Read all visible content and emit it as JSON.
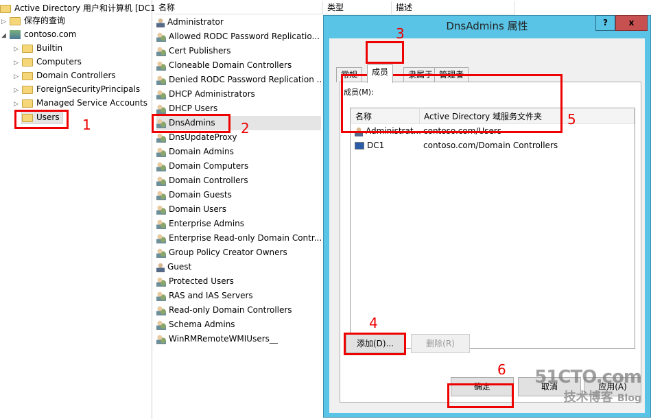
{
  "tree": {
    "root": "Active Directory 用户和计算机 [DC1.",
    "items": [
      {
        "label": "保存的查询",
        "expander": "collapsed"
      },
      {
        "label": "contoso.com",
        "expander": "expanded"
      },
      {
        "label": "Builtin",
        "expander": "collapsed"
      },
      {
        "label": "Computers",
        "expander": "collapsed"
      },
      {
        "label": "Domain Controllers",
        "expander": "collapsed"
      },
      {
        "label": "ForeignSecurityPrincipals",
        "expander": "collapsed"
      },
      {
        "label": "Managed Service Accounts",
        "expander": "collapsed"
      },
      {
        "label": "Users",
        "selected": true
      }
    ]
  },
  "list": {
    "columns": [
      "名称",
      "类型",
      "描述"
    ],
    "rows": [
      {
        "name": "Administrator",
        "icon": "user-icon"
      },
      {
        "name": "Allowed RODC Password Replicatio...",
        "icon": "group-icon"
      },
      {
        "name": "Cert Publishers",
        "icon": "group-icon"
      },
      {
        "name": "Cloneable Domain Controllers",
        "icon": "group-icon"
      },
      {
        "name": "Denied RODC Password Replication ...",
        "icon": "group-icon"
      },
      {
        "name": "DHCP Administrators",
        "icon": "group-icon"
      },
      {
        "name": "DHCP Users",
        "icon": "group-icon"
      },
      {
        "name": "DnsAdmins",
        "icon": "group-icon",
        "selected": true
      },
      {
        "name": "DnsUpdateProxy",
        "icon": "group-icon"
      },
      {
        "name": "Domain Admins",
        "icon": "group-icon"
      },
      {
        "name": "Domain Computers",
        "icon": "group-icon"
      },
      {
        "name": "Domain Controllers",
        "icon": "group-icon"
      },
      {
        "name": "Domain Guests",
        "icon": "group-icon"
      },
      {
        "name": "Domain Users",
        "icon": "group-icon"
      },
      {
        "name": "Enterprise Admins",
        "icon": "group-icon"
      },
      {
        "name": "Enterprise Read-only Domain Contr...",
        "icon": "group-icon"
      },
      {
        "name": "Group Policy Creator Owners",
        "icon": "group-icon"
      },
      {
        "name": "Guest",
        "icon": "user-icon"
      },
      {
        "name": "Protected Users",
        "icon": "group-icon"
      },
      {
        "name": "RAS and IAS Servers",
        "icon": "group-icon"
      },
      {
        "name": "Read-only Domain Controllers",
        "icon": "group-icon"
      },
      {
        "name": "Schema Admins",
        "icon": "group-icon"
      },
      {
        "name": "WinRMRemoteWMIUsers__",
        "icon": "group-icon"
      }
    ]
  },
  "dialog": {
    "title": "DnsAdmins 属性",
    "help": "?",
    "close": "x",
    "tabs": [
      "常规",
      "成员",
      "隶属于",
      "管理者"
    ],
    "active_tab": "成员",
    "members_label": "成员(M):",
    "members_columns": [
      "名称",
      "Active Directory 域服务文件夹"
    ],
    "members": [
      {
        "name": "Administrat...",
        "folder": "contoso.com/Users",
        "icon": "user-icon"
      },
      {
        "name": "DC1",
        "folder": "contoso.com/Domain Controllers",
        "icon": "computer-icon"
      }
    ],
    "add": "添加(D)...",
    "remove": "删除(R)",
    "ok": "确定",
    "cancel": "取消",
    "apply": "应用(A)"
  },
  "annotations": [
    "1",
    "2",
    "3",
    "4",
    "5",
    "6"
  ],
  "watermark": {
    "line1": "51CTO.com",
    "line2": "技术博客",
    "line3": "Blog"
  },
  "colors": {
    "dialog_frame": "#5ac4e6",
    "annotation": "#e00000",
    "close_button": "#c75050"
  }
}
